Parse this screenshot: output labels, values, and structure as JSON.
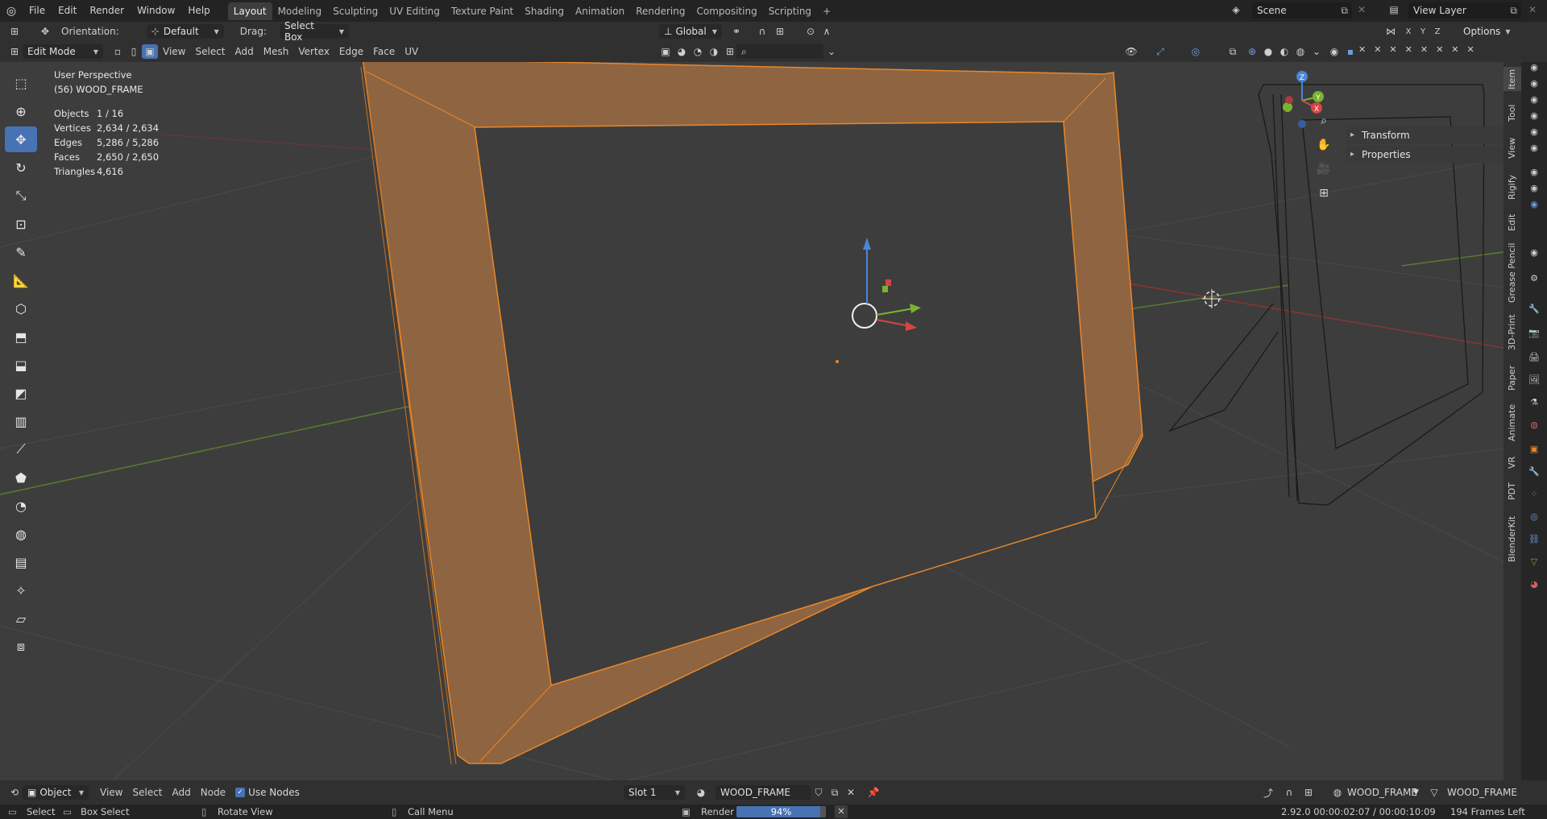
{
  "topbar": {
    "menus": [
      "File",
      "Edit",
      "Render",
      "Window",
      "Help"
    ],
    "workspaces": [
      "Layout",
      "Modeling",
      "Sculpting",
      "UV Editing",
      "Texture Paint",
      "Shading",
      "Animation",
      "Rendering",
      "Compositing",
      "Scripting"
    ],
    "active_workspace": "Layout",
    "scene": "Scene",
    "view_layer": "View Layer"
  },
  "tool_header": {
    "orientation_label": "Orientation:",
    "orientation_value": "Default",
    "drag_label": "Drag:",
    "drag_value": "Select Box",
    "transform_orientation": "Global",
    "options_label": "Options",
    "axes": [
      "X",
      "Y",
      "Z"
    ]
  },
  "viewport_header": {
    "mode": "Edit Mode",
    "menus": [
      "View",
      "Select",
      "Add",
      "Mesh",
      "Vertex",
      "Edge",
      "Face",
      "UV"
    ]
  },
  "overlay": {
    "perspective": "User Perspective",
    "object_name": "(56) WOOD_FRAME",
    "stats": [
      {
        "label": "Objects",
        "value": "1 / 16"
      },
      {
        "label": "Vertices",
        "value": "2,634 / 2,634"
      },
      {
        "label": "Edges",
        "value": "5,286 / 5,286"
      },
      {
        "label": "Faces",
        "value": "2,650 / 2,650"
      },
      {
        "label": "Triangles",
        "value": "4,616"
      }
    ]
  },
  "n_panel": {
    "sections": [
      "Transform",
      "Properties"
    ]
  },
  "side_tabs": [
    "Item",
    "Tool",
    "View",
    "Rigify",
    "Edit",
    "Grease Pencil",
    "3D-Print",
    "Paper",
    "Animate",
    "VR",
    "PDT",
    "BlenderKit"
  ],
  "active_side_tab": "Item",
  "gizmo": {
    "x": "X",
    "y": "Y",
    "z": "Z"
  },
  "bottom_header": {
    "object_mode": "Object",
    "menus": [
      "View",
      "Select",
      "Add",
      "Node"
    ],
    "use_nodes_label": "Use Nodes",
    "slot": "Slot 1",
    "material": "WOOD_FRAME",
    "right_object": "WOOD_FRAME",
    "right_data": "WOOD_FRAME"
  },
  "statusbar": {
    "select": "Select",
    "box_select": "Box Select",
    "rotate_view": "Rotate View",
    "call_menu": "Call Menu",
    "render_label": "Render",
    "render_progress": 0.94,
    "render_progress_text": "94%",
    "version_time": "2.92.0  00:00:02:07 / 00:00:10:09",
    "frames_left": "194 Frames Left"
  },
  "colors": {
    "accent": "#4772b3",
    "selection": "#e8882a",
    "frame_fill": "#8f6440",
    "viewport_bg": "#3d3d3d"
  }
}
